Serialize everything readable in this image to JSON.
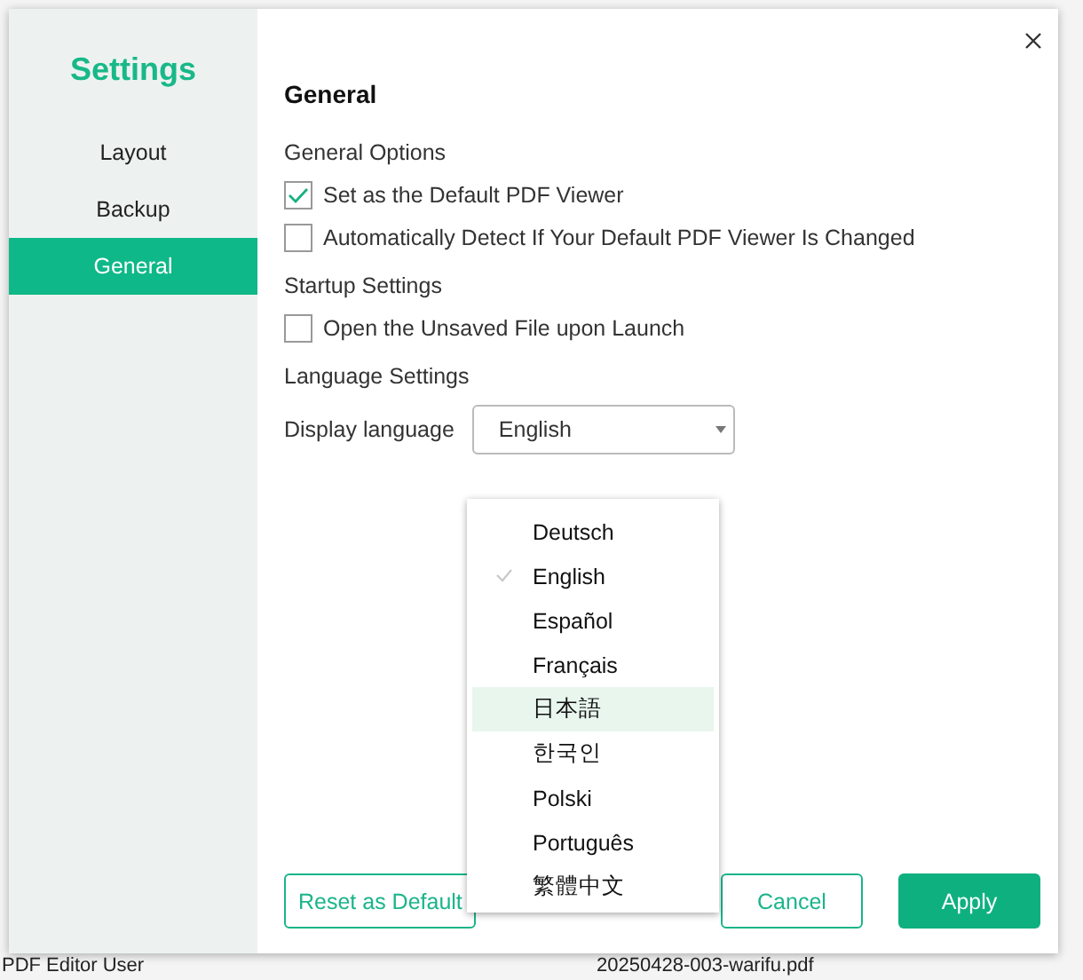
{
  "background": {
    "texts": [
      "PDF Editor User",
      "20250428-003-warifu.pdf"
    ]
  },
  "sidebar": {
    "title": "Settings",
    "items": [
      {
        "label": "Layout",
        "selected": false
      },
      {
        "label": "Backup",
        "selected": false
      },
      {
        "label": "General",
        "selected": true
      }
    ]
  },
  "main": {
    "heading": "General",
    "sections": [
      {
        "title": "General Options",
        "options": [
          {
            "label": "Set as the Default PDF Viewer",
            "checked": true
          },
          {
            "label": "Automatically Detect If Your Default PDF Viewer Is Changed",
            "checked": false
          }
        ]
      },
      {
        "title": "Startup Settings",
        "options": [
          {
            "label": "Open the Unsaved File upon Launch",
            "checked": false
          }
        ]
      },
      {
        "title": "Language Settings"
      }
    ],
    "language": {
      "label": "Display language",
      "value": "English",
      "expanded": true,
      "options": [
        {
          "label": "Deutsch",
          "selected": false,
          "hovered": false
        },
        {
          "label": "English",
          "selected": true,
          "hovered": false
        },
        {
          "label": "Español",
          "selected": false,
          "hovered": false
        },
        {
          "label": "Français",
          "selected": false,
          "hovered": false
        },
        {
          "label": "日本語",
          "selected": false,
          "hovered": true
        },
        {
          "label": "한국인",
          "selected": false,
          "hovered": false
        },
        {
          "label": "Polski",
          "selected": false,
          "hovered": false
        },
        {
          "label": "Português",
          "selected": false,
          "hovered": false
        },
        {
          "label": "繁體中文",
          "selected": false,
          "hovered": false
        }
      ]
    }
  },
  "buttons": {
    "reset": "Reset as Default",
    "cancel": "Cancel",
    "apply": "Apply"
  }
}
